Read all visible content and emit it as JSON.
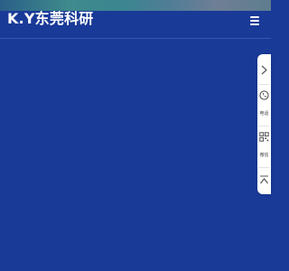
{
  "header": {
    "logo_text": "K.Y东莞科研",
    "menu_icon": "hamburger-menu-icon"
  },
  "side_panel": {
    "items": [
      {
        "icon": "chevron-right-icon",
        "label": ""
      },
      {
        "icon": "phone-icon",
        "label": "电话"
      },
      {
        "icon": "qr-code-icon",
        "label": "微信"
      },
      {
        "icon": "back-to-top-icon",
        "label": ""
      }
    ]
  },
  "colors": {
    "background": "#1a3a98",
    "header_strip": "#3f8a8c",
    "panel": "#ffffff",
    "text_on_background": "#ffffff",
    "panel_text": "#444444"
  }
}
